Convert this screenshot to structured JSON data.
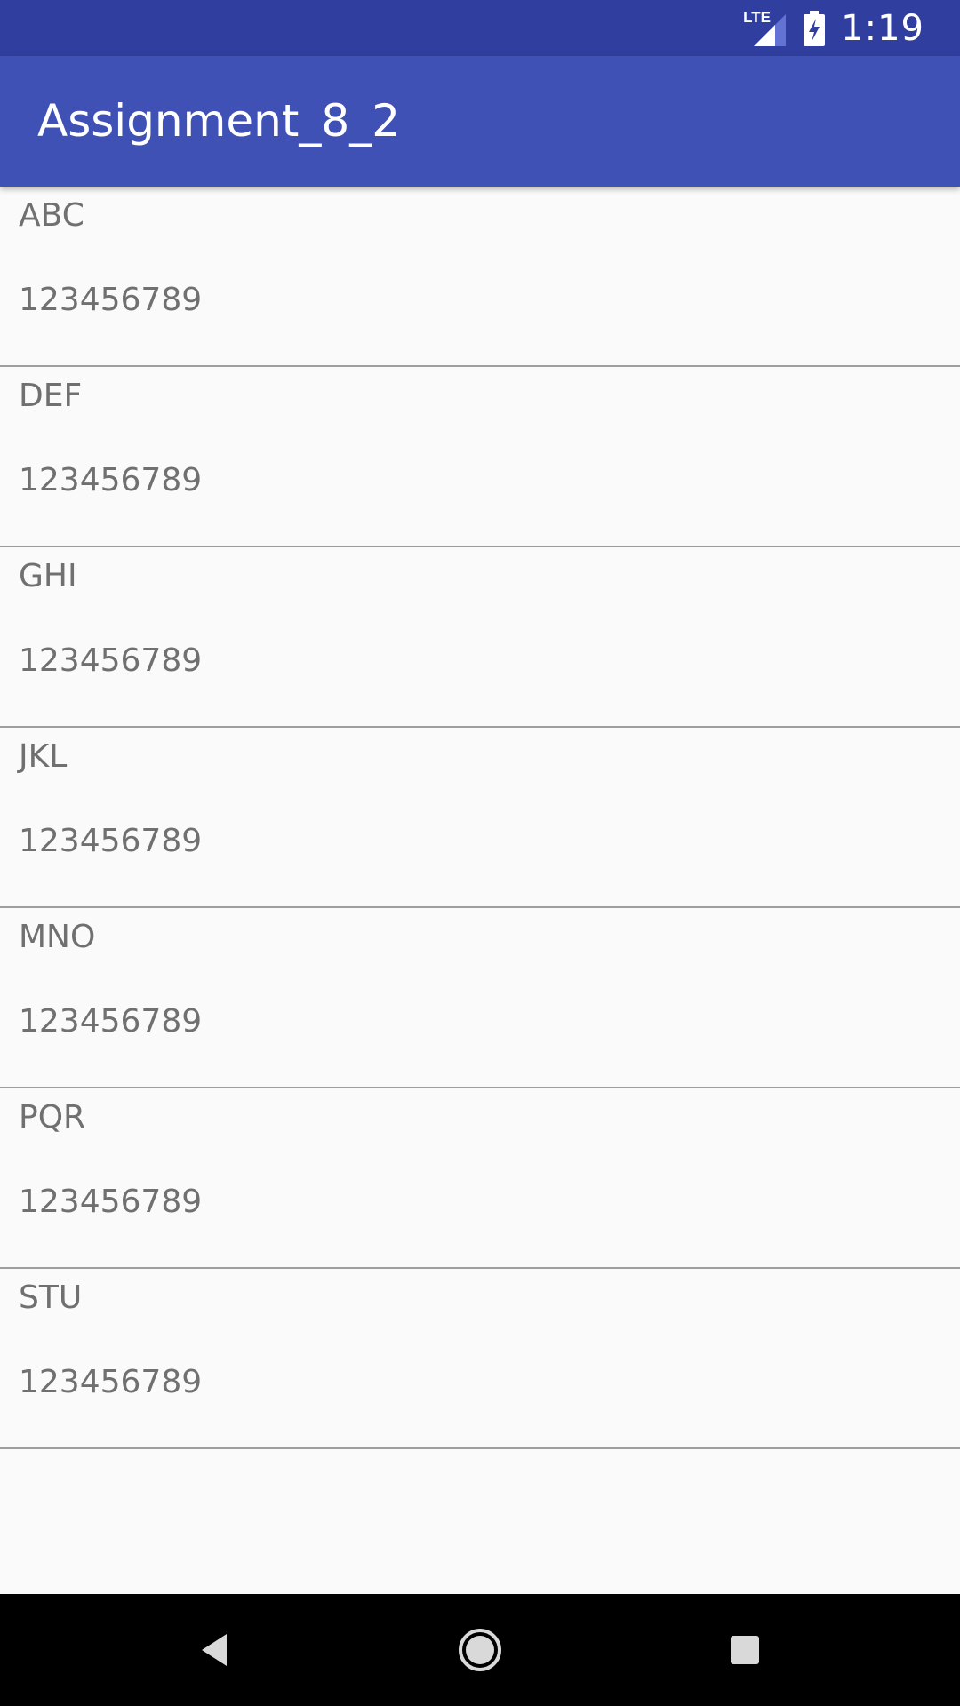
{
  "status_bar": {
    "network_label": "LTE",
    "time": "1:19",
    "icons": [
      "lte-icon",
      "signal-icon",
      "battery-charging-icon"
    ]
  },
  "app_bar": {
    "title": "Assignment_8_2"
  },
  "contacts": [
    {
      "name": "ABC",
      "number": "123456789"
    },
    {
      "name": "DEF",
      "number": "123456789"
    },
    {
      "name": "GHI",
      "number": "123456789"
    },
    {
      "name": "JKL",
      "number": "123456789"
    },
    {
      "name": "MNO",
      "number": "123456789"
    },
    {
      "name": "PQR",
      "number": "123456789"
    },
    {
      "name": "STU",
      "number": "123456789"
    }
  ],
  "nav_bar": {
    "buttons": [
      "back-icon",
      "home-icon",
      "recents-icon"
    ]
  },
  "colors": {
    "status_bar": "#303F9F",
    "app_bar": "#3F51B5",
    "background": "#FAFAFA",
    "divider": "#9E9E9E",
    "text": "#707070"
  }
}
